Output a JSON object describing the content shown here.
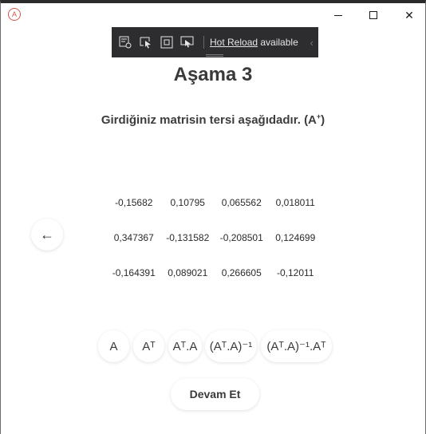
{
  "window": {
    "app_icon_glyph": "A",
    "minimize_icon": "minimize-icon",
    "maximize_icon": "maximize-icon",
    "close_glyph": "✕"
  },
  "devbar": {
    "hot_reload_link": "Hot Reload",
    "hot_reload_status": " available",
    "chevron": "‹"
  },
  "page": {
    "title": "Aşama 3",
    "subtitle_text": "Girdiğiniz matrisin tersi aşağıdadır. (A",
    "subtitle_sup": "+",
    "subtitle_close": ")",
    "back_glyph": "←"
  },
  "matrix": [
    [
      "-0,15682",
      "0,10795",
      "0,065562",
      "0,018011"
    ],
    [
      "0,347367",
      "-0,131582",
      "-0,208501",
      "0,124699"
    ],
    [
      "-0,164391",
      "0,089021",
      "0,266605",
      "-0,12011"
    ]
  ],
  "operations": {
    "a": "A",
    "at": "Aᵀ",
    "at_a": "Aᵀ.A",
    "at_a_inv": "(Aᵀ.A)⁻¹",
    "at_a_inv_at": "(Aᵀ.A)⁻¹.Aᵀ"
  },
  "actions": {
    "continue": "Devam Et"
  }
}
